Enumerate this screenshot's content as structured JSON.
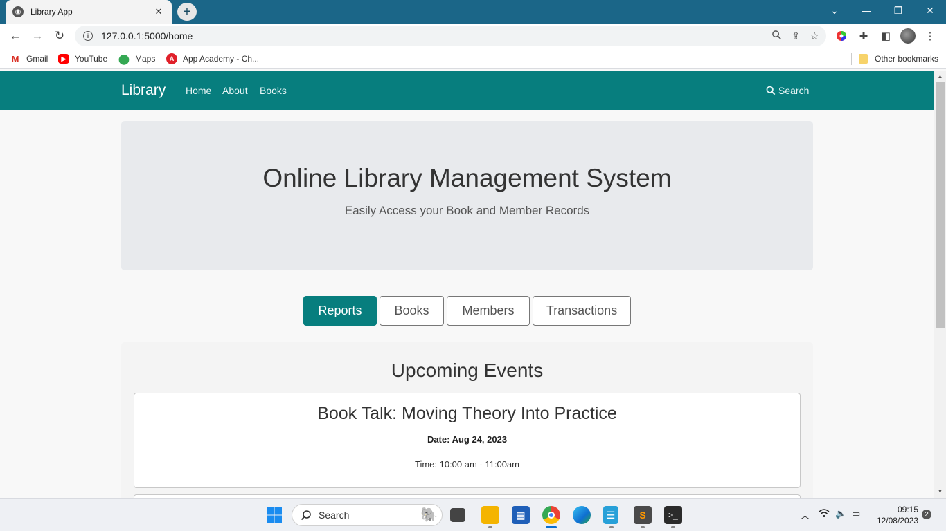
{
  "browser": {
    "tab_title": "Library App",
    "url": "127.0.0.1:5000/home",
    "bookmarks": [
      {
        "label": "Gmail"
      },
      {
        "label": "YouTube"
      },
      {
        "label": "Maps"
      },
      {
        "label": "App Academy - Ch..."
      }
    ],
    "other_bookmarks": "Other bookmarks"
  },
  "navbar": {
    "brand": "Library",
    "links": [
      "Home",
      "About",
      "Books"
    ],
    "search_label": "Search"
  },
  "hero": {
    "title": "Online Library Management System",
    "subtitle": "Easily Access your Book and Member Records"
  },
  "section_tabs": [
    {
      "label": "Reports",
      "active": true
    },
    {
      "label": "Books",
      "active": false
    },
    {
      "label": "Members",
      "active": false
    },
    {
      "label": "Transactions",
      "active": false
    }
  ],
  "events": {
    "heading": "Upcoming Events",
    "items": [
      {
        "title": "Book Talk: Moving Theory Into Practice",
        "date": "Date: Aug 24, 2023",
        "time": "Time: 10:00 am - 11:00am"
      }
    ]
  },
  "taskbar": {
    "search_label": "Search",
    "time": "09:15",
    "date": "12/08/2023",
    "notification_count": "2"
  },
  "colors": {
    "accent": "#077e7e",
    "browser_frame": "#1b6688"
  }
}
